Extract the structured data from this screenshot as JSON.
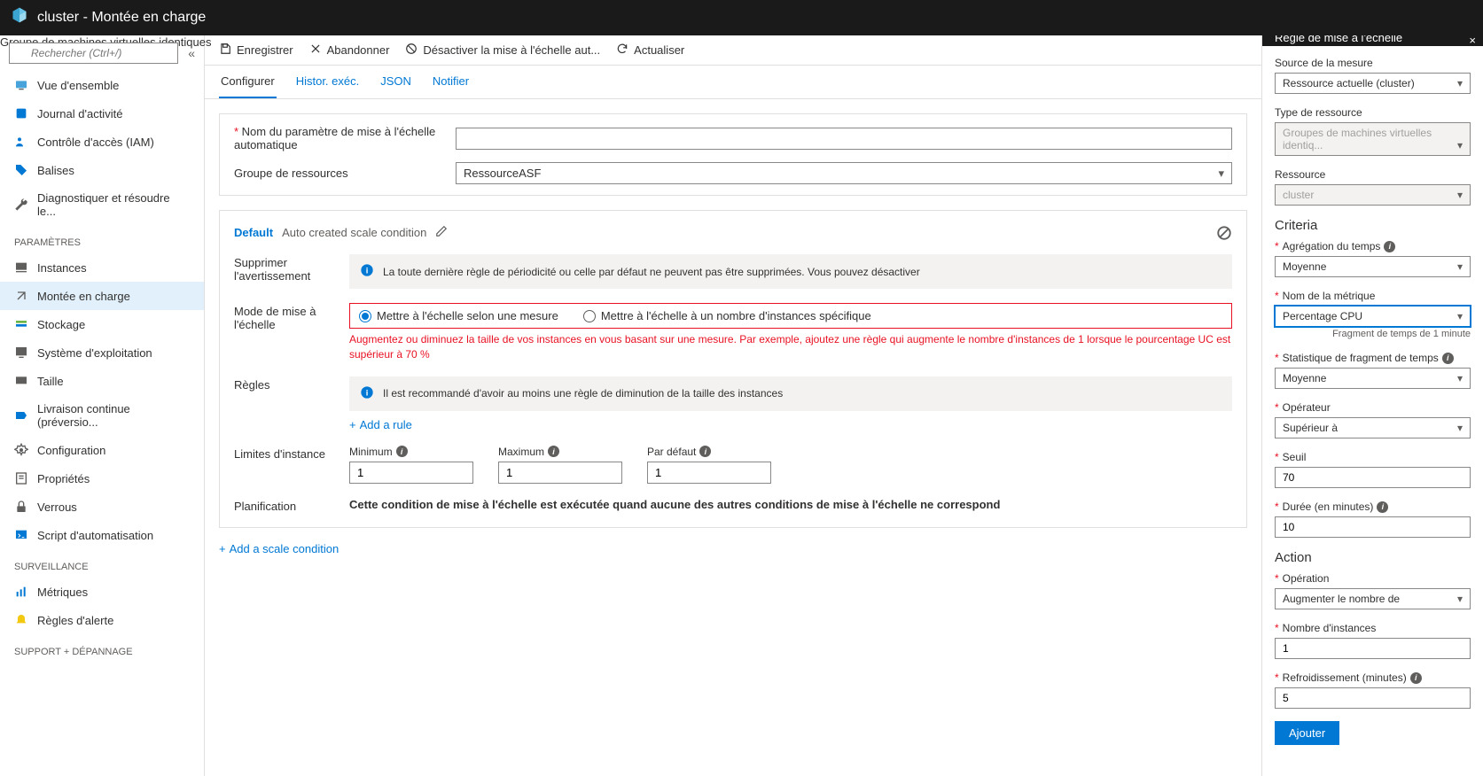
{
  "topbar": {
    "title": "cluster - Montée en charge",
    "subtitle": "Groupe de machines virtuelles identiques"
  },
  "search": {
    "placeholder": "Rechercher (Ctrl+/)"
  },
  "nav": {
    "overview": "Vue d'ensemble",
    "activity": "Journal d'activité",
    "iam": "Contrôle d'accès (IAM)",
    "tags": "Balises",
    "diagnose": "Diagnostiquer et résoudre le...",
    "section_params": "PARAMÈTRES",
    "instances": "Instances",
    "scaling": "Montée en charge",
    "storage": "Stockage",
    "os": "Système d'exploitation",
    "size": "Taille",
    "cd": "Livraison continue (préversio...",
    "config": "Configuration",
    "props": "Propriétés",
    "locks": "Verrous",
    "script": "Script d'automatisation",
    "section_surv": "SURVEILLANCE",
    "metrics": "Métriques",
    "alerts": "Règles d'alerte",
    "section_support": "SUPPORT + DÉPANNAGE"
  },
  "toolbar": {
    "save": "Enregistrer",
    "discard": "Abandonner",
    "disable": "Désactiver la mise à l'échelle aut...",
    "refresh": "Actualiser"
  },
  "tabs": {
    "configure": "Configurer",
    "history": "Histor. exéc.",
    "json": "JSON",
    "notify": "Notifier"
  },
  "form": {
    "name_label": "Nom du paramètre de mise à l'échelle automatique",
    "rg_label": "Groupe de ressources",
    "rg_value": "RessourceASF"
  },
  "condition": {
    "default": "Default",
    "title": "Auto created scale condition",
    "delete_warn_label": "Supprimer l'avertissement",
    "delete_warn_text": "La toute dernière règle de périodicité ou celle par défaut ne peuvent pas être supprimées. Vous pouvez désactiver",
    "mode_label": "Mode de mise à l'échelle",
    "mode_opt1": "Mettre à l'échelle selon une mesure",
    "mode_opt2": "Mettre à l'échelle à un nombre d'instances spécifique",
    "mode_desc": "Augmentez ou diminuez la taille de vos instances en vous basant sur une mesure. Par exemple, ajoutez une règle qui augmente le nombre d'instances de 1 lorsque le pourcentage UC est supérieur à 70 %",
    "rules_label": "Règles",
    "rules_info": "Il est recommandé d'avoir au moins une règle de diminution de la taille des instances",
    "add_rule": "Add a rule",
    "limits_label": "Limites d'instance",
    "min_label": "Minimum",
    "min_value": "1",
    "max_label": "Maximum",
    "max_value": "1",
    "def_label": "Par défaut",
    "def_value": "1",
    "plan_label": "Planification",
    "plan_text": "Cette condition de mise à l'échelle est exécutée quand aucune des autres conditions de mise à l'échelle ne correspond"
  },
  "add_scale_cond": "Add a scale condition",
  "panel": {
    "title": "Règle de mise à l'échelle",
    "source_label": "Source de la mesure",
    "source_value": "Ressource actuelle (cluster)",
    "restype_label": "Type de ressource",
    "restype_value": "Groupes de machines virtuelles identiq...",
    "resource_label": "Ressource",
    "resource_value": "cluster",
    "criteria_heading": "Criteria",
    "timeagg_label": "Agrégation du temps",
    "timeagg_value": "Moyenne",
    "metric_label": "Nom de la métrique",
    "metric_value": "Percentage CPU",
    "metric_hint": "Fragment de temps de 1 minute",
    "stat_label": "Statistique de fragment de temps",
    "stat_value": "Moyenne",
    "op_label": "Opérateur",
    "op_value": "Supérieur à",
    "threshold_label": "Seuil",
    "threshold_value": "70",
    "duration_label": "Durée (en minutes)",
    "duration_value": "10",
    "action_heading": "Action",
    "operation_label": "Opération",
    "operation_value": "Augmenter le nombre de",
    "count_label": "Nombre d'instances",
    "count_value": "1",
    "cooldown_label": "Refroidissement (minutes)",
    "cooldown_value": "5",
    "add_btn": "Ajouter"
  }
}
